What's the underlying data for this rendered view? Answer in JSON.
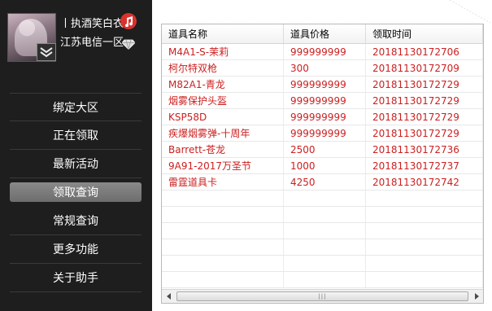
{
  "profile": {
    "nickname": "丨执酒笑白衣",
    "server": "江苏电信一区"
  },
  "menu": {
    "items": [
      {
        "label": "绑定大区"
      },
      {
        "label": "正在领取"
      },
      {
        "label": "最新活动"
      },
      {
        "label": "领取查询",
        "active": true
      },
      {
        "label": "常规查询"
      },
      {
        "label": "更多功能"
      },
      {
        "label": "关于助手"
      }
    ]
  },
  "table": {
    "columns": [
      "道具名称",
      "道具价格",
      "领取时间"
    ],
    "rows": [
      [
        "M4A1-S-茉莉",
        "999999999",
        "20181130172706"
      ],
      [
        "柯尔特双枪",
        "300",
        "20181130172709"
      ],
      [
        "M82A1-青龙",
        "999999999",
        "20181130172729"
      ],
      [
        "烟雾保护头盔",
        "999999999",
        "20181130172729"
      ],
      [
        "KSP58D",
        "999999999",
        "20181130172729"
      ],
      [
        "疾爆烟雾弹-十周年",
        "999999999",
        "20181130172729"
      ],
      [
        "Barrett-苍龙",
        "2500",
        "20181130172736"
      ],
      [
        "9A91-2017万圣节",
        "1000",
        "20181130172737"
      ],
      [
        "雷霆道具卡",
        "4250",
        "20181130172742"
      ]
    ]
  },
  "icons": {
    "music": "music-note-icon",
    "diamond": "diamond-icon",
    "vip": "vip-chevron-icon"
  },
  "colors": {
    "sidebar_bg": "#1e1e1e",
    "row_text": "#cc1f1f",
    "music_badge": "#d8322e",
    "active_menu": "#7c7c7c"
  }
}
